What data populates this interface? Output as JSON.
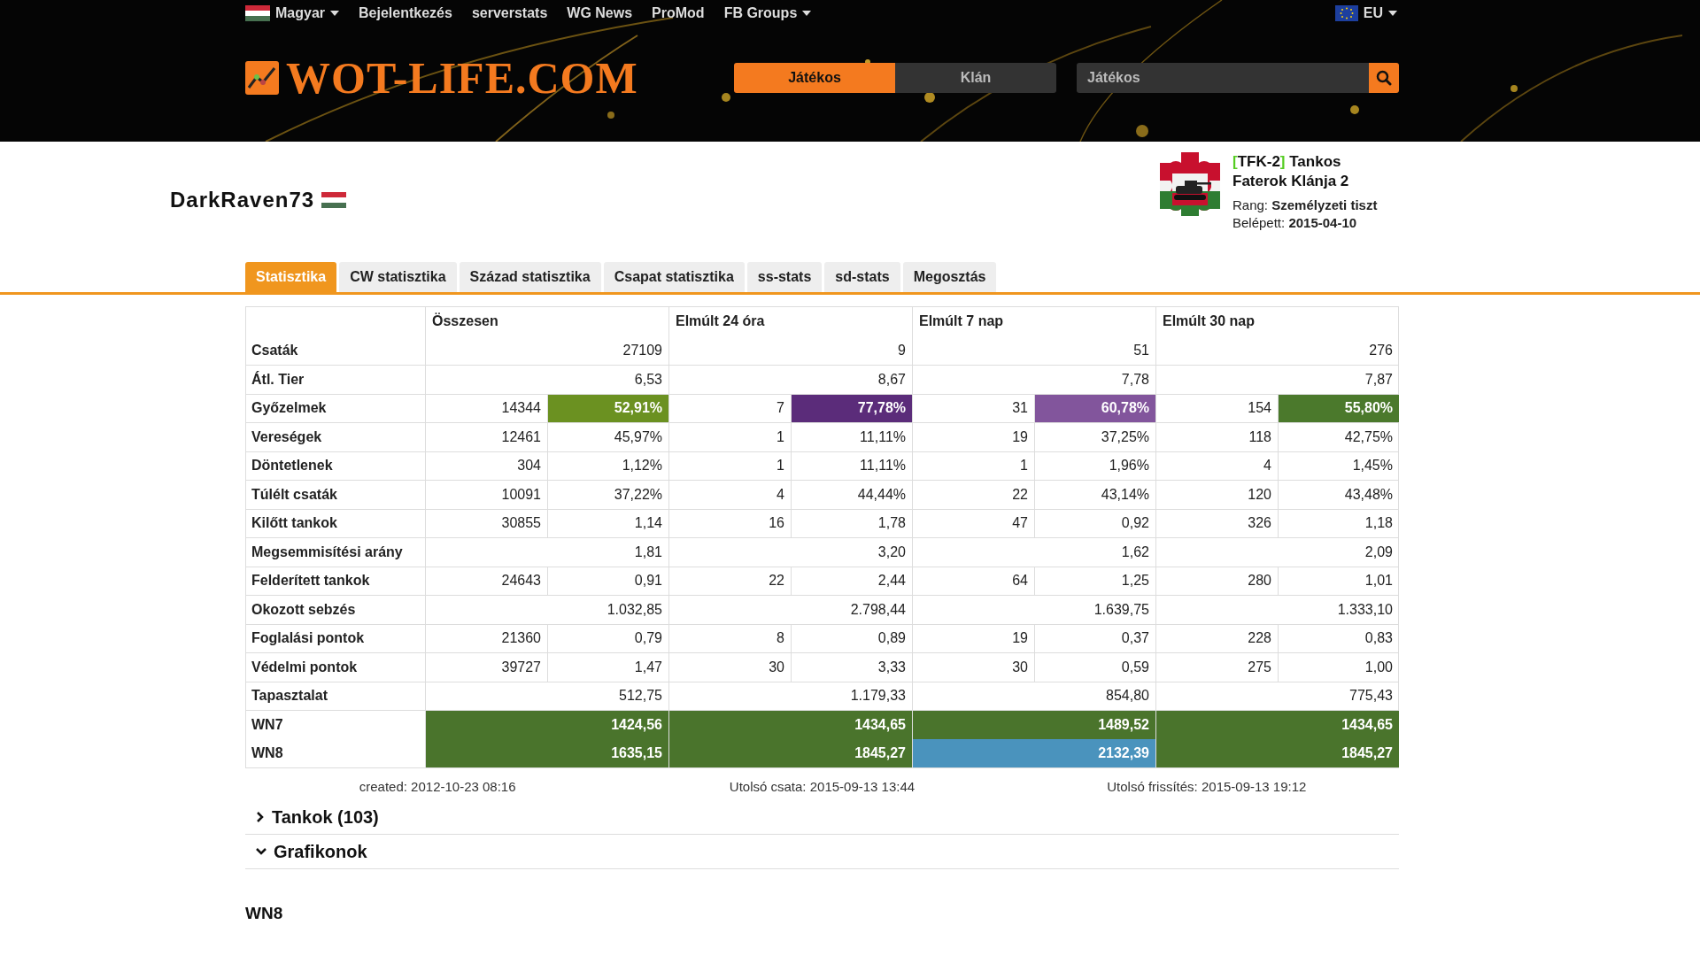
{
  "nav": {
    "items": [
      {
        "label": "Magyar",
        "kind": "language"
      },
      {
        "label": "Bejelentkezés",
        "kind": "link"
      },
      {
        "label": "serverstats",
        "kind": "link"
      },
      {
        "label": "WG News",
        "kind": "link"
      },
      {
        "label": "ProMod",
        "kind": "link"
      },
      {
        "label": "FB Groups",
        "kind": "dropdown"
      }
    ],
    "region": {
      "label": "EU"
    }
  },
  "logo": {
    "text": "WOT-LIFE.COM"
  },
  "search_mode": [
    {
      "label": "Játékos",
      "selected": true
    },
    {
      "label": "Klán",
      "selected": false
    }
  ],
  "search": {
    "placeholder": "Játékos"
  },
  "player": {
    "name": "DarkRaven73"
  },
  "clan": {
    "bracket_open": "[",
    "tag": "TFK-2",
    "bracket_close": "]",
    "name": "Tankos Faterok Klánja 2",
    "rank": "Rang: **Személyzeti tiszt**",
    "joined": "Belépett: **2015-04-10**"
  },
  "tabs": [
    {
      "label": "Statisztika",
      "selected": true
    },
    {
      "label": "CW statisztika",
      "selected": false
    },
    {
      "label": "Század statisztika",
      "selected": false
    },
    {
      "label": "Csapat statisztika",
      "selected": false
    },
    {
      "label": "ss-stats",
      "selected": false
    },
    {
      "label": "sd-stats",
      "selected": false
    },
    {
      "label": "Megosztás",
      "selected": false
    }
  ],
  "table": {
    "columns": [
      "Összesen",
      "Elmúlt 24 óra",
      "Elmúlt 7 nap",
      "Elmúlt 30 nap"
    ],
    "rows": [
      {
        "label": "Csaták",
        "kind": "single",
        "cells": [
          {
            "value": "27109"
          },
          {
            "value": "9"
          },
          {
            "value": "51"
          },
          {
            "value": "276"
          }
        ]
      },
      {
        "label": "Átl. Tier",
        "kind": "single",
        "cells": [
          {
            "value": "6,53"
          },
          {
            "value": "8,67"
          },
          {
            "value": "7,78"
          },
          {
            "value": "7,87"
          }
        ]
      },
      {
        "label": "Győzelmek",
        "kind": "split",
        "cells": [
          {
            "count": "14344",
            "value": "52,91%",
            "color": "#6b9121"
          },
          {
            "count": "7",
            "value": "77,78%",
            "color": "#5b2c7a"
          },
          {
            "count": "31",
            "value": "60,78%",
            "color": "#82559c"
          },
          {
            "count": "154",
            "value": "55,80%",
            "color": "#4b792c"
          }
        ]
      },
      {
        "label": "Vereségek",
        "kind": "split",
        "cells": [
          {
            "count": "12461",
            "value": "45,97%"
          },
          {
            "count": "1",
            "value": "11,11%"
          },
          {
            "count": "19",
            "value": "37,25%"
          },
          {
            "count": "118",
            "value": "42,75%"
          }
        ]
      },
      {
        "label": "Döntetlenek",
        "kind": "split",
        "cells": [
          {
            "count": "304",
            "value": "1,12%"
          },
          {
            "count": "1",
            "value": "11,11%"
          },
          {
            "count": "1",
            "value": "1,96%"
          },
          {
            "count": "4",
            "value": "1,45%"
          }
        ]
      },
      {
        "label": "Túlélt csaták",
        "kind": "split",
        "cells": [
          {
            "count": "10091",
            "value": "37,22%"
          },
          {
            "count": "4",
            "value": "44,44%"
          },
          {
            "count": "22",
            "value": "43,14%"
          },
          {
            "count": "120",
            "value": "43,48%"
          }
        ]
      },
      {
        "label": "Kilőtt tankok",
        "kind": "split",
        "cells": [
          {
            "count": "30855",
            "value": "1,14"
          },
          {
            "count": "16",
            "value": "1,78"
          },
          {
            "count": "47",
            "value": "0,92"
          },
          {
            "count": "326",
            "value": "1,18"
          }
        ]
      },
      {
        "label": "Megsemmisítési arány",
        "kind": "single",
        "cells": [
          {
            "value": "1,81"
          },
          {
            "value": "3,20"
          },
          {
            "value": "1,62"
          },
          {
            "value": "2,09"
          }
        ]
      },
      {
        "label": "Felderített tankok",
        "kind": "split",
        "cells": [
          {
            "count": "24643",
            "value": "0,91"
          },
          {
            "count": "22",
            "value": "2,44"
          },
          {
            "count": "64",
            "value": "1,25"
          },
          {
            "count": "280",
            "value": "1,01"
          }
        ]
      },
      {
        "label": "Okozott sebzés",
        "kind": "single",
        "cells": [
          {
            "value": "1.032,85"
          },
          {
            "value": "2.798,44"
          },
          {
            "value": "1.639,75"
          },
          {
            "value": "1.333,10"
          }
        ]
      },
      {
        "label": "Foglalási pontok",
        "kind": "split",
        "cells": [
          {
            "count": "21360",
            "value": "0,79"
          },
          {
            "count": "8",
            "value": "0,89"
          },
          {
            "count": "19",
            "value": "0,37"
          },
          {
            "count": "228",
            "value": "0,83"
          }
        ]
      },
      {
        "label": "Védelmi pontok",
        "kind": "split",
        "cells": [
          {
            "count": "39727",
            "value": "1,47"
          },
          {
            "count": "30",
            "value": "3,33"
          },
          {
            "count": "30",
            "value": "0,59"
          },
          {
            "count": "275",
            "value": "1,00"
          }
        ]
      },
      {
        "label": "Tapasztalat",
        "kind": "single",
        "cells": [
          {
            "value": "512,75"
          },
          {
            "value": "1.179,33"
          },
          {
            "value": "854,80"
          },
          {
            "value": "775,43"
          }
        ]
      },
      {
        "label": "WN7",
        "kind": "rating",
        "cells": [
          {
            "value": "1424,56",
            "color": "#4a742c"
          },
          {
            "value": "1434,65",
            "color": "#4a742c"
          },
          {
            "value": "1489,52",
            "color": "#4a742c"
          },
          {
            "value": "1434,65",
            "color": "#4a742c"
          }
        ]
      },
      {
        "label": "WN8",
        "kind": "rating",
        "cells": [
          {
            "value": "1635,15",
            "color": "#4a742c"
          },
          {
            "value": "1845,27",
            "color": "#4a742c"
          },
          {
            "value": "2132,39",
            "color": "#4a93bd"
          },
          {
            "value": "1845,27",
            "color": "#4a742c"
          }
        ]
      }
    ]
  },
  "footer": [
    "created: 2012-10-23 08:16",
    "Utolsó csata: 2015-09-13 13:44",
    "Utolsó frissítés: 2015-09-13 19:12"
  ],
  "sections": [
    {
      "title": "Tankok (103)",
      "expanded": false
    },
    {
      "title": "Grafikonok",
      "expanded": true
    }
  ],
  "chart_heading": "WN8"
}
